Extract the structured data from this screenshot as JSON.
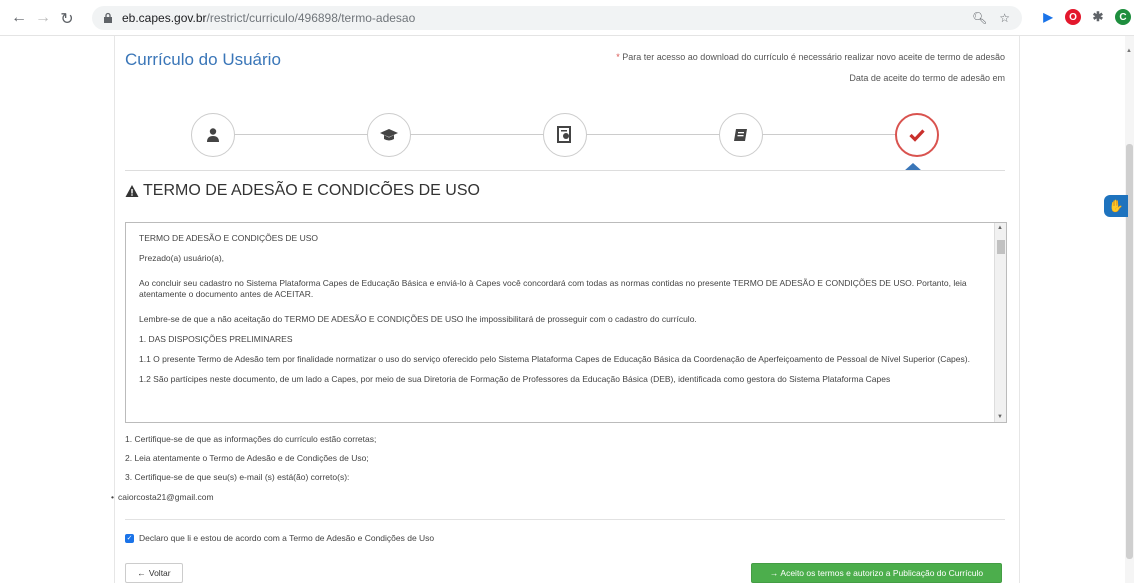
{
  "browser": {
    "url_host": "eb.capes.gov.br",
    "url_path": "/restrict/curriculo/496898/termo-adesao",
    "profile_initial": "C"
  },
  "header": {
    "title": "Currículo do Usuário",
    "notice_star": "*",
    "notice": " Para ter acesso ao download do currículo é necessário realizar novo aceite de termo de adesão",
    "accept_date_label": "Data de aceite do termo de adesão em"
  },
  "steps": [
    {
      "icon": "user-icon"
    },
    {
      "icon": "graduation-cap-icon"
    },
    {
      "icon": "certificate-icon"
    },
    {
      "icon": "book-icon"
    },
    {
      "icon": "check-icon",
      "active": true
    }
  ],
  "section": {
    "title": "TERMO DE ADESÃO E CONDICÕES DE USO"
  },
  "terms": {
    "p1": "TERMO DE ADESÃO E CONDIÇÕES DE USO",
    "p2": "Prezado(a) usuário(a),",
    "p3": "Ao concluir seu cadastro no Sistema Plataforma Capes de Educação Básica e enviá-lo à Capes você concordará com todas as normas contidas no presente TERMO DE ADESÃO E CONDIÇÕES DE USO. Portanto, leia atentamente o documento antes de ACEITAR.",
    "p4": "Lembre-se de que a não aceitação do TERMO DE ADESÃO E CONDIÇÕES DE USO lhe impossibilitará de prosseguir com o cadastro do currículo.",
    "p5": "1. DAS DISPOSIÇÕES PRELIMINARES",
    "p6": "1.1 O presente Termo de Adesão tem por finalidade normatizar o uso do serviço oferecido pelo Sistema Plataforma Capes de Educação Básica da Coordenação de Aperfeiçoamento de Pessoal de Nível Superior (Capes).",
    "p7": "1.2 São partícipes neste documento, de um lado a Capes, por meio de sua Diretoria de Formação de Professores da Educação Básica (DEB), identificada como gestora do Sistema Plataforma Capes"
  },
  "checklist": [
    "1. Certifique-se de que as informações do currículo estão corretas;",
    "2. Leia atentamente o Termo de Adesão e de Condições de Uso;",
    "3. Certifique-se de que seu(s) e-mail (s) está(ão) correto(s):"
  ],
  "email": "caiorcosta21@gmail.com",
  "agree_label": "Declaro que li e estou de acordo com a Termo de Adesão e Condições de Uso",
  "buttons": {
    "back": "Voltar",
    "accept": "Aceito os termos e autorizo a Publicação do Currículo"
  },
  "colors": {
    "title_blue": "#3a76b8",
    "accept_green": "#4cae4c",
    "active_red": "#d9534f"
  }
}
